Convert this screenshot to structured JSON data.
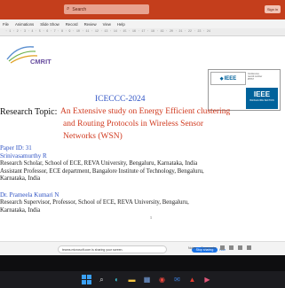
{
  "app": {
    "search_placeholder": "Search",
    "sign_in_label": "Sign in"
  },
  "menu": [
    "File",
    "Animations",
    "Slide Show",
    "Record",
    "Review",
    "View",
    "Help"
  ],
  "ruler_text": "· 1 · 2 · 3 · 4 · 5 · 6 · 7 · 8 · 9 · 10 · 11 · 12 · 13 · 14 · 15 · 16 · 17 · 18 · 19 · 20 · 21 · 22 · 23 · 24",
  "slide": {
    "cmrit_label": "CMRIT",
    "ieee_top_label": "IEEE",
    "ieee_conf_lines": [
      "Conference",
      "record number",
      "#5767"
    ],
    "ieee_bottom_label": "IEEE",
    "ieee_bottom_sub": "BANGALORE SECTION",
    "conference": "ICECCC-2024",
    "research_topic_label": "Research Topic:",
    "research_topic_lines": [
      "An Extensive study on Energy Efficient clustering",
      "and Routing Protocols in Wireless Sensor",
      "Networks (WSN)"
    ],
    "paper_id": "Paper ID: 31",
    "author1_name": "Srinivasamurthy R",
    "author1_line1": "Research Scholar, School of ECE, REVA University, Bengaluru, Karnataka, India",
    "author1_line2": "Assistant Professor, ECE department, Bangalore Institute of Technology, Bengaluru,",
    "author1_line3": "Karnataka, India",
    "author2_name": "Dr. Prameela Kumari N",
    "author2_line1": "Research Supervisor, Professor, School of ECE, REVA University, Bengaluru,",
    "author2_line2": "Karnataka, India",
    "page_number": "1"
  },
  "status": {
    "share_text": "teams.microsoft.com is sharing your screen.",
    "stop_label": "Stop sharing",
    "hide_label": "Hide",
    "notes_label": "Notes",
    "comments_label": "Comments"
  }
}
